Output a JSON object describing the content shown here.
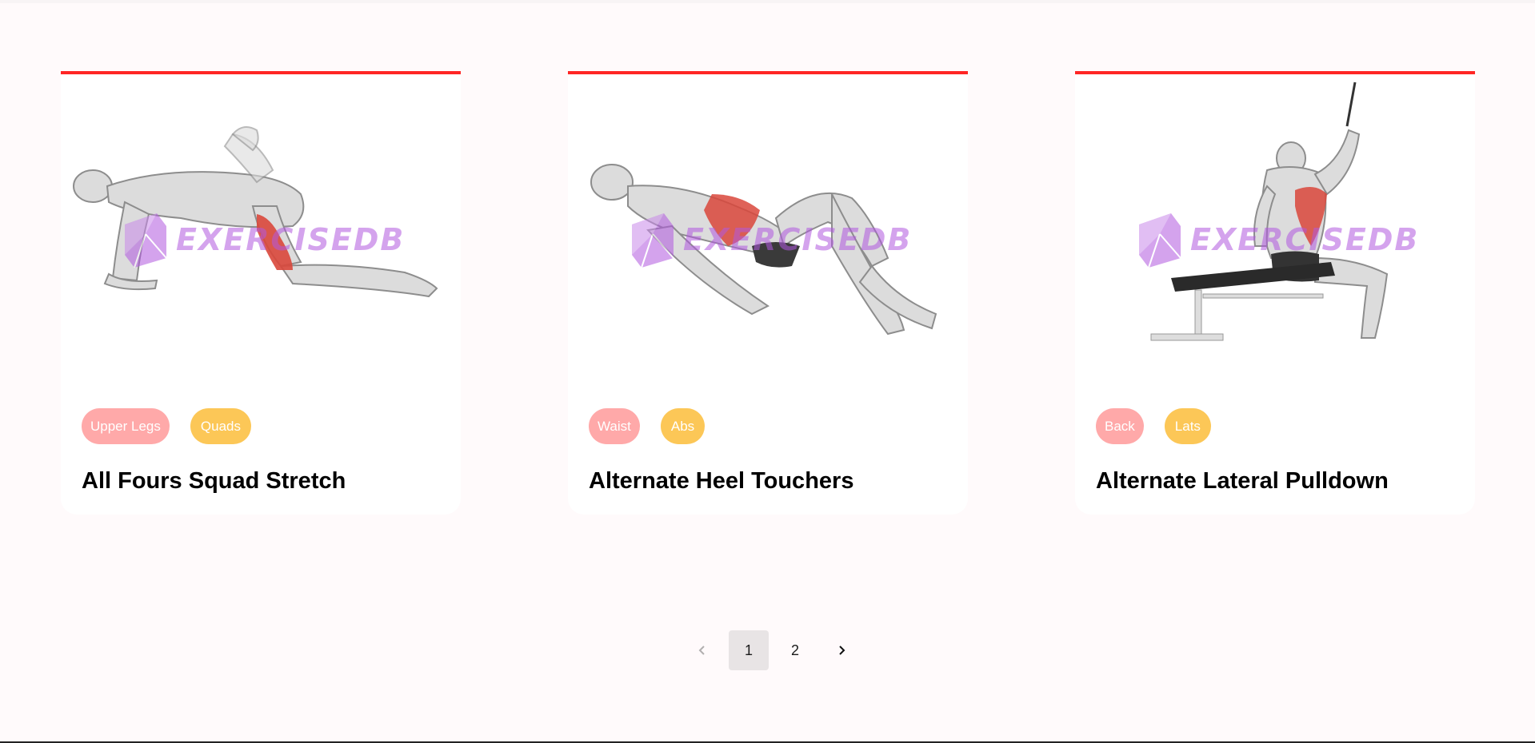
{
  "exercises": [
    {
      "name": "All Fours Squad Stretch",
      "body_part": "Upper Legs",
      "target": "Quads",
      "watermark": "EXERCISEDB"
    },
    {
      "name": "Alternate Heel Touchers",
      "body_part": "Waist",
      "target": "Abs",
      "watermark": "EXERCISEDB"
    },
    {
      "name": "Alternate Lateral Pulldown",
      "body_part": "Back",
      "target": "Lats",
      "watermark": "EXERCISEDB"
    }
  ],
  "pagination": {
    "pages": [
      "1",
      "2"
    ],
    "current": "1"
  },
  "colors": {
    "accent": "#ff2625",
    "body_part_tag": "#ffa9a9",
    "target_tag": "#fcc757",
    "watermark": "#b158e0",
    "muscle_highlight": "#d9473b"
  },
  "icons": {
    "prev": "chevron-left-icon",
    "next": "chevron-right-icon",
    "watermark_logo": "cube-logo-icon"
  }
}
